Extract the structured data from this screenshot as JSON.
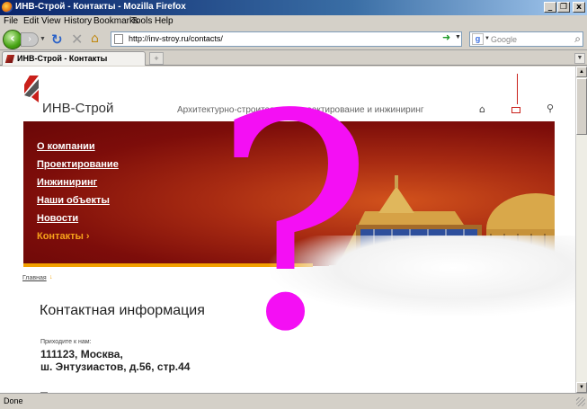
{
  "window": {
    "title": "ИНВ-Строй - Контакты - Mozilla Firefox",
    "minimize": "_",
    "maximize": "❐",
    "close": "x"
  },
  "menu": [
    "File",
    "Edit",
    "View",
    "History",
    "Bookmarks",
    "Tools",
    "Help"
  ],
  "toolbar": {
    "url": "http://inv-stroy.ru/contacts/",
    "search_placeholder": "Google"
  },
  "tab": {
    "label": "ИНВ-Строй - Контакты",
    "new_tab": "+"
  },
  "site": {
    "logo_text": "ИНВ-Строй",
    "tagline": "Архитектурно-строительное проектирование и инжиниринг",
    "nav": [
      "О компании",
      "Проектирование",
      "Инжиниринг",
      "Наши объекты",
      "Новости",
      "Контакты ›"
    ],
    "breadcrumb": "Главная",
    "contact_title": "Контактная информация",
    "come_label": "Приходите к нам:",
    "address_line1": "111123, Москва,",
    "address_line2": "ш. Энтузиастов, д.56, стр.44"
  },
  "overlay": {
    "symbol": "?"
  },
  "status": "Done",
  "colors": {
    "banner_red": "#7d0d0a",
    "active_nav": "#f7a21b",
    "overlay": "#f40ff4",
    "accent_orange": "#f2a000"
  }
}
